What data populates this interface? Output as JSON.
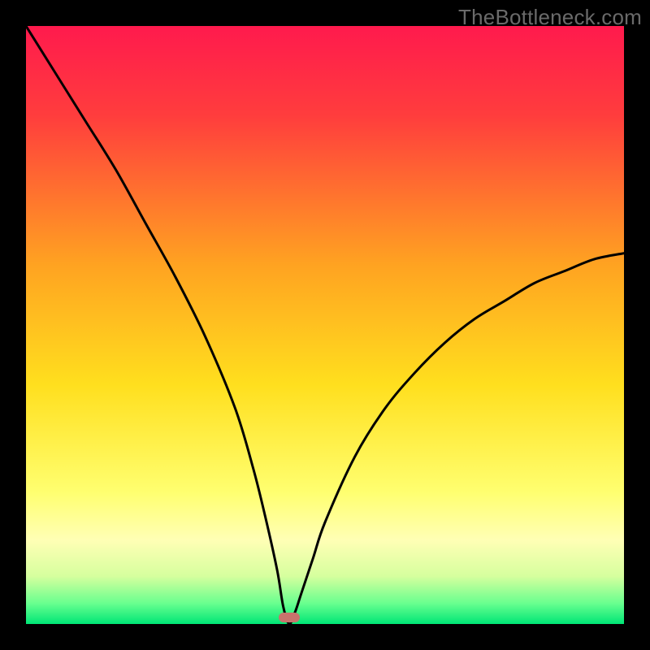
{
  "watermark": "TheBottleneck.com",
  "chart_data": {
    "type": "line",
    "title": "",
    "xlabel": "",
    "ylabel": "",
    "x_range": [
      0,
      100
    ],
    "y_range": [
      0,
      100
    ],
    "background": {
      "type": "vertical-gradient",
      "stops": [
        {
          "pos": 0.0,
          "color": "#ff1a4d"
        },
        {
          "pos": 0.15,
          "color": "#ff3d3d"
        },
        {
          "pos": 0.4,
          "color": "#ffa321"
        },
        {
          "pos": 0.6,
          "color": "#ffdf1e"
        },
        {
          "pos": 0.78,
          "color": "#ffff70"
        },
        {
          "pos": 0.86,
          "color": "#ffffb5"
        },
        {
          "pos": 0.92,
          "color": "#d6ff9e"
        },
        {
          "pos": 0.965,
          "color": "#6aff8f"
        },
        {
          "pos": 1.0,
          "color": "#00e676"
        }
      ]
    },
    "series": [
      {
        "name": "bottleneck-curve",
        "color": "#000000",
        "note": "V-shaped curve; y is percent bottleneck, minimum (0) near x≈44, rising to ~100 at x=0 and ~62 at x=100",
        "x": [
          0,
          5,
          10,
          15,
          20,
          25,
          30,
          35,
          38,
          40,
          42,
          43,
          44,
          45,
          46,
          48,
          50,
          55,
          60,
          65,
          70,
          75,
          80,
          85,
          90,
          95,
          100
        ],
        "y": [
          100,
          92,
          84,
          76,
          67,
          58,
          48,
          36,
          26,
          18,
          9,
          3,
          0,
          2,
          5,
          11,
          17,
          28,
          36,
          42,
          47,
          51,
          54,
          57,
          59,
          61,
          62
        ]
      }
    ],
    "marker": {
      "x": 44,
      "y": 0,
      "color": "#c8736c"
    }
  }
}
